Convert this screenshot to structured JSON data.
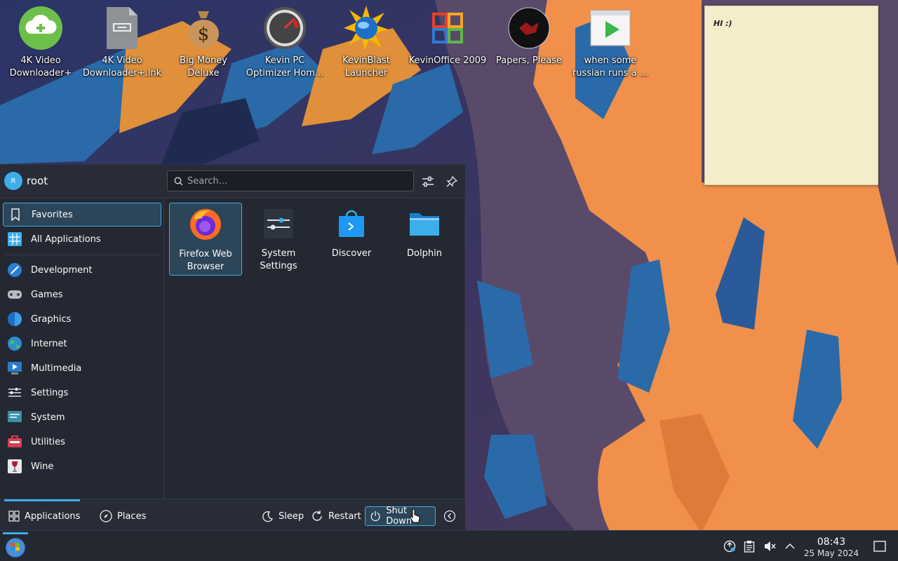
{
  "desktop": {
    "icons": [
      {
        "label": "4K Video\nDownloader+",
        "icon": "4k-downloader-icon"
      },
      {
        "label": "4K Video\nDownloader+.lnk",
        "icon": "shortcut-file-icon"
      },
      {
        "label": "Big Money\nDeluxe",
        "icon": "money-bag-icon"
      },
      {
        "label": "Kevin PC\nOptimizer Hom...",
        "icon": "gauge-icon"
      },
      {
        "label": "KevinBlast\nLauncher",
        "icon": "globe-burst-icon"
      },
      {
        "label": "KevinOffice 2009",
        "icon": "office-icon"
      },
      {
        "label": "Papers, Please",
        "icon": "papers-please-icon"
      },
      {
        "label": "when some\nrussian runs a ...",
        "icon": "video-file-icon"
      }
    ],
    "note_text": "HI :)"
  },
  "launcher": {
    "username": "root",
    "avatar_letter": "R",
    "search_placeholder": "Search...",
    "categories": [
      {
        "label": "Favorites",
        "icon": "bookmark-icon"
      },
      {
        "label": "All Applications",
        "icon": "grid-icon"
      },
      {
        "label": "Development",
        "icon": "development-icon"
      },
      {
        "label": "Games",
        "icon": "gamepad-icon"
      },
      {
        "label": "Graphics",
        "icon": "graphics-icon"
      },
      {
        "label": "Internet",
        "icon": "globe-icon"
      },
      {
        "label": "Multimedia",
        "icon": "multimedia-icon"
      },
      {
        "label": "Settings",
        "icon": "settings-icon"
      },
      {
        "label": "System",
        "icon": "system-icon"
      },
      {
        "label": "Utilities",
        "icon": "utilities-icon"
      },
      {
        "label": "Wine",
        "icon": "wine-icon"
      }
    ],
    "favorites": [
      {
        "label": "Firefox Web\nBrowser",
        "icon": "firefox-icon"
      },
      {
        "label": "System\nSettings",
        "icon": "system-settings-icon"
      },
      {
        "label": "Discover",
        "icon": "discover-icon"
      },
      {
        "label": "Dolphin",
        "icon": "folder-icon"
      }
    ],
    "footer": {
      "applications": "Applications",
      "places": "Places",
      "sleep": "Sleep",
      "restart": "Restart",
      "shutdown": "Shut Down"
    }
  },
  "taskbar": {
    "time": "08:43",
    "date": "25 May 2024"
  },
  "colors": {
    "accent": "#3daee9",
    "menu_bg": "#232832",
    "taskbar_bg": "#242831",
    "note_bg": "#f4edca"
  }
}
